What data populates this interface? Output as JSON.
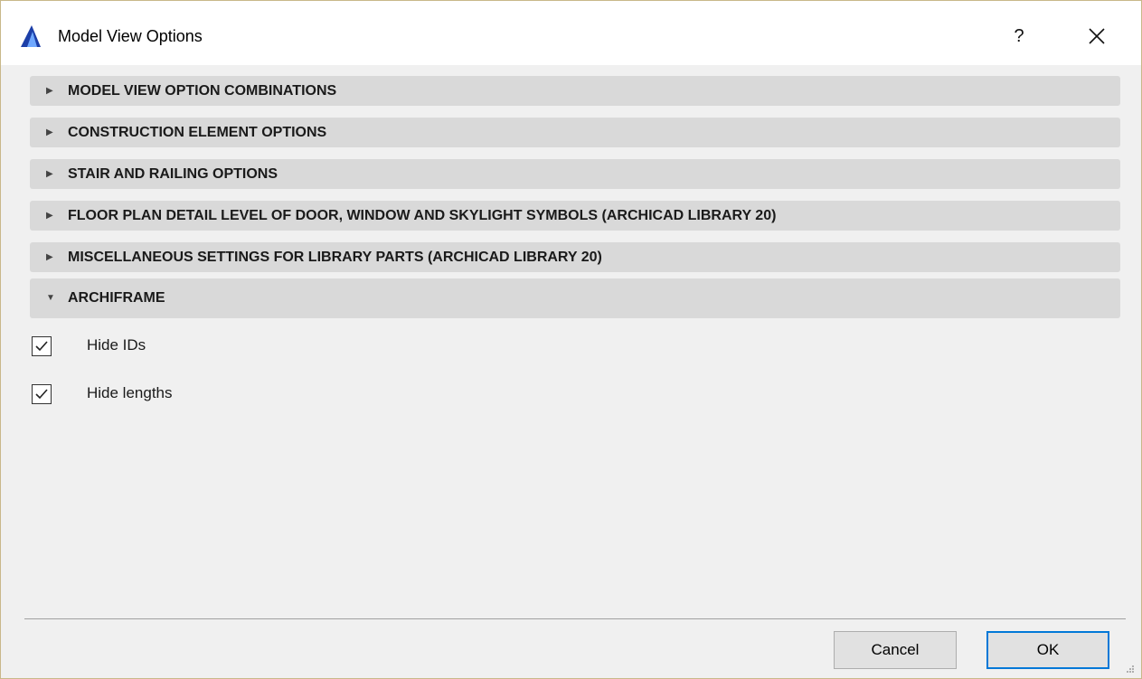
{
  "window": {
    "title": "Model View Options",
    "help_label": "?",
    "close_label": "✕"
  },
  "sections": [
    {
      "label": "MODEL VIEW OPTION COMBINATIONS",
      "expanded": false
    },
    {
      "label": "CONSTRUCTION ELEMENT OPTIONS",
      "expanded": false
    },
    {
      "label": "STAIR AND RAILING OPTIONS",
      "expanded": false
    },
    {
      "label": "FLOOR PLAN DETAIL LEVEL OF DOOR, WINDOW AND SKYLIGHT SYMBOLS (ARCHICAD LIBRARY 20)",
      "expanded": false
    },
    {
      "label": "MISCELLANEOUS SETTINGS FOR LIBRARY PARTS (ARCHICAD LIBRARY 20)",
      "expanded": false
    },
    {
      "label": "ARCHIFRAME",
      "expanded": true
    }
  ],
  "archiframe": {
    "options": [
      {
        "label": "Hide IDs",
        "checked": true
      },
      {
        "label": "Hide lengths",
        "checked": true
      }
    ]
  },
  "footer": {
    "cancel_label": "Cancel",
    "ok_label": "OK"
  },
  "icons": {
    "collapsed": "triangle-right-icon",
    "expanded": "triangle-down-icon",
    "app": "archicad-icon"
  },
  "colors": {
    "accent": "#0078d7",
    "section_bg": "#d9d9d9",
    "dialog_bg": "#f0f0f0"
  }
}
